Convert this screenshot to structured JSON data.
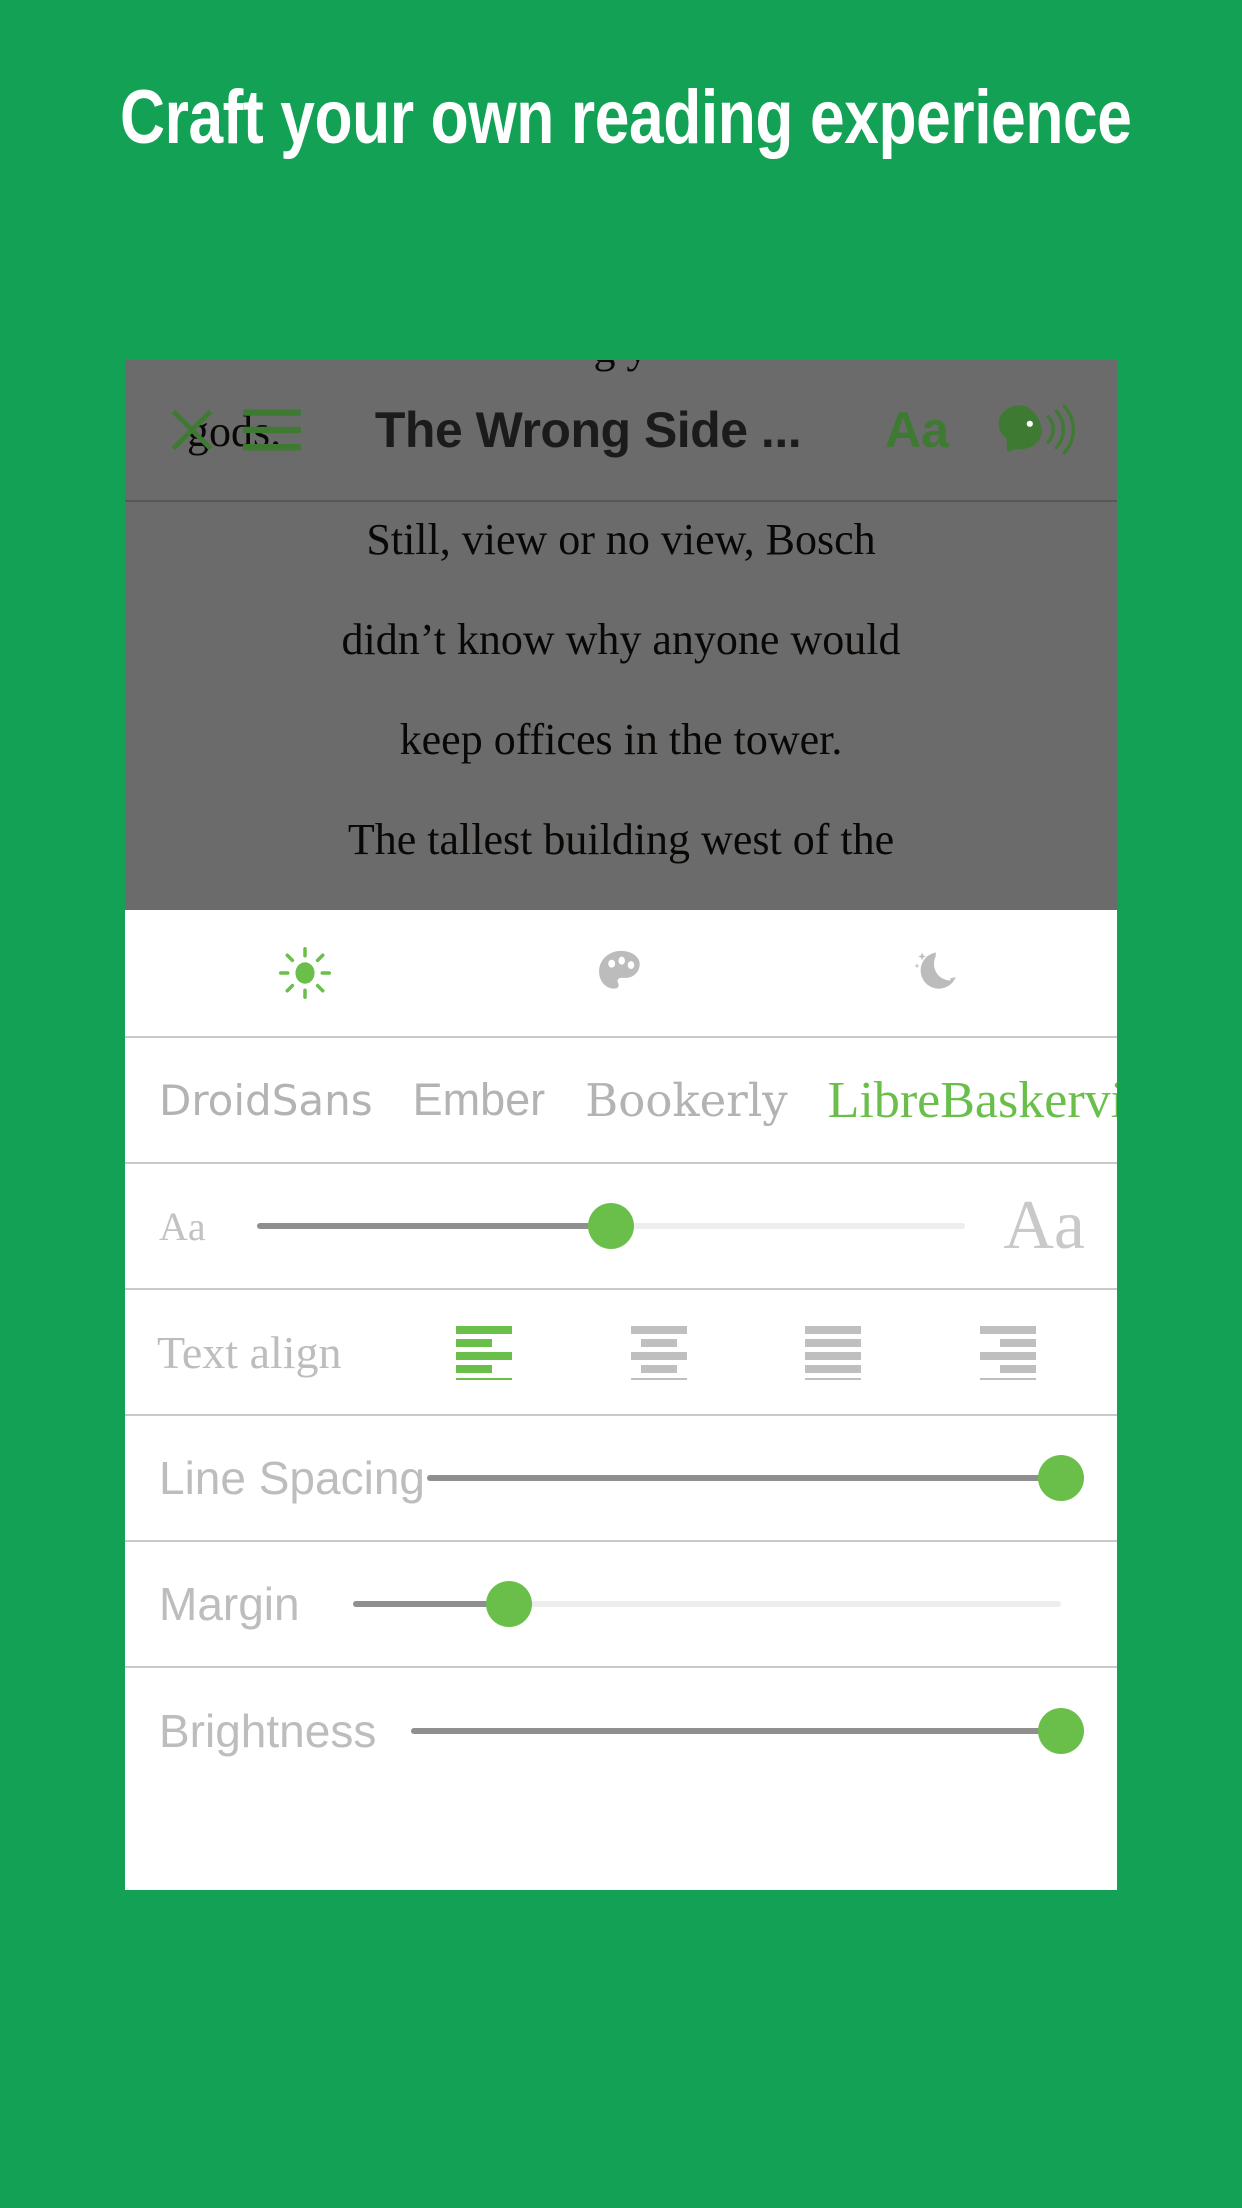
{
  "page": {
    "headline": "Craft your own reading experience",
    "background_color": "#13a156",
    "accent_green": "#6abf4b",
    "toolbar_green": "#3f7a33"
  },
  "reader": {
    "partial_top_line": "g                              y",
    "overlap_word": "gods.",
    "paragraph_line_1": "Still, view or no view, Bosch",
    "paragraph_line_2": "didn’t know why anyone would",
    "paragraph_line_3": "keep offices in the tower.",
    "paragraph_line_4": "The tallest building west of the"
  },
  "toolbar": {
    "close_label": "×",
    "menu_label": "menu",
    "title": "The Wrong Side ...",
    "font_button_label": "Aa",
    "tts_label": "text-to-speech"
  },
  "settings": {
    "themes": [
      {
        "name": "light",
        "icon": "sun-icon",
        "active": true,
        "color": "#6abf4b"
      },
      {
        "name": "sepia",
        "icon": "palette-icon",
        "active": false,
        "color": "#bcbcbc"
      },
      {
        "name": "dark",
        "icon": "moon-icon",
        "active": false,
        "color": "#bcbcbc"
      }
    ],
    "fonts": [
      {
        "label": "DroidSans",
        "selected": false
      },
      {
        "label": "Ember",
        "selected": false
      },
      {
        "label": "Bookerly",
        "selected": false
      },
      {
        "label": "LibreBaskerville",
        "selected": true
      }
    ],
    "font_size": {
      "small_label": "Aa",
      "large_label": "Aa",
      "value_percent": 50
    },
    "text_align": {
      "label": "Text align",
      "options": [
        {
          "name": "align-left",
          "selected": true
        },
        {
          "name": "align-center",
          "selected": false
        },
        {
          "name": "align-justify",
          "selected": false
        },
        {
          "name": "align-right",
          "selected": false
        }
      ]
    },
    "line_spacing": {
      "label": "Line Spacing",
      "value_percent": 100
    },
    "margin": {
      "label": "Margin",
      "value_percent": 22
    },
    "brightness": {
      "label": "Brightness",
      "value_percent": 100
    }
  }
}
